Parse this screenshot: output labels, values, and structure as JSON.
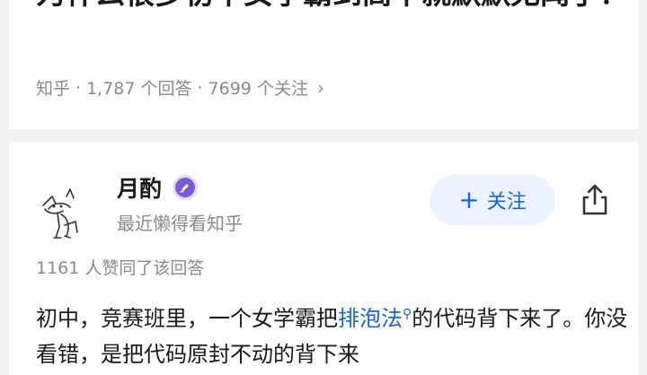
{
  "question": {
    "title": "为什么很多初中女学霸到高中就默默无闻了？",
    "meta": {
      "source": "知乎",
      "answers": "1,787 个回答",
      "followers": "7699 个关注",
      "sep": "·",
      "chevron": "›"
    }
  },
  "answer": {
    "author": {
      "name": "月酌",
      "bio": "最近懒得看知乎",
      "avatar_icon": "cat-sketch-avatar",
      "badge_icon": "pen-badge-icon"
    },
    "follow_button": {
      "plus": "+",
      "label": "关注"
    },
    "share_icon": "share-icon",
    "likes": "1161 人赞同了该回答",
    "content": {
      "before": "初中，竞赛班里，一个女学霸把",
      "keyword": "排泡法",
      "keyword_icon": "search-icon",
      "after": "的代码背下来了。你没看错，是把代码原封不动的背下来"
    }
  },
  "colors": {
    "accent": "#1963e6",
    "follow_bg": "#ecf2ff",
    "badge": "#7b5ad6",
    "meta_text": "#8a8a8a",
    "background": "#f2f2f2"
  }
}
